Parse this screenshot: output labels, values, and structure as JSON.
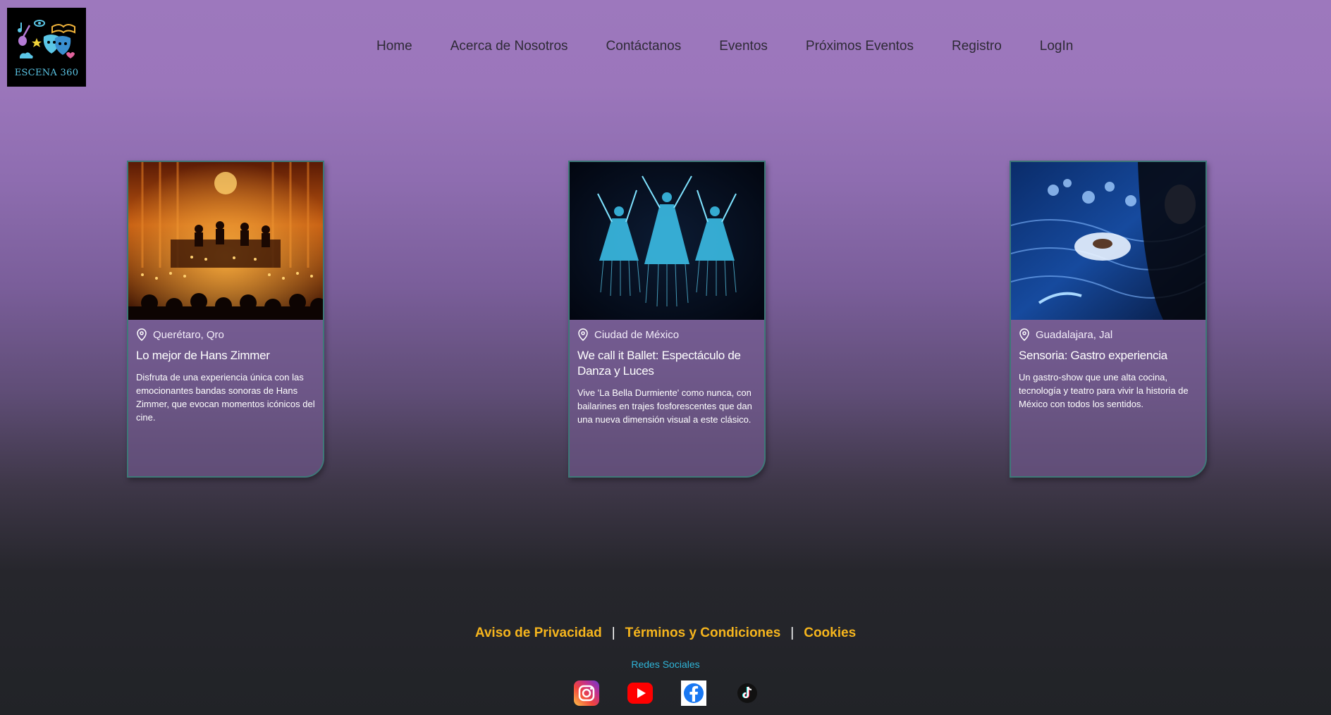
{
  "logo": {
    "text": "ESCENA 360"
  },
  "nav": [
    {
      "label": "Home"
    },
    {
      "label": "Acerca de Nosotros"
    },
    {
      "label": "Contáctanos"
    },
    {
      "label": "Eventos"
    },
    {
      "label": "Próximos Eventos"
    },
    {
      "label": "Registro"
    },
    {
      "label": "LogIn"
    }
  ],
  "cards": [
    {
      "location": "Querétaro, Qro",
      "title": "Lo mejor de Hans Zimmer",
      "description": "Disfruta de una experiencia única con las emocionantes bandas sonoras de Hans Zimmer, que evocan momentos icónicos del cine.",
      "image_theme": "candlelight-concert"
    },
    {
      "location": "Ciudad de México",
      "title": "We call it Ballet: Espectáculo de Danza y Luces",
      "description": "Vive 'La Bella Durmiente' como nunca, con bailarines en trajes fosforescentes que dan una nueva dimensión visual a este clásico.",
      "image_theme": "glowing-ballet"
    },
    {
      "location": "Guadalajara, Jal",
      "title": "Sensoria: Gastro experiencia",
      "description": "Un gastro-show que une alta cocina, tecnología y teatro para vivir la historia de México con todos los sentidos.",
      "image_theme": "projection-dinner"
    }
  ],
  "footer": {
    "privacy": "Aviso de Privacidad",
    "sep1": "|",
    "terms": "Términos y Condiciones",
    "sep2": "|",
    "cookies": "Cookies",
    "social_title": "Redes Sociales",
    "social": [
      "instagram-icon",
      "youtube-icon",
      "facebook-icon",
      "tiktok-icon"
    ]
  },
  "colors": {
    "accent": "#f6b51d",
    "social_title": "#2fb4d7",
    "card_border": "#3e7878"
  }
}
